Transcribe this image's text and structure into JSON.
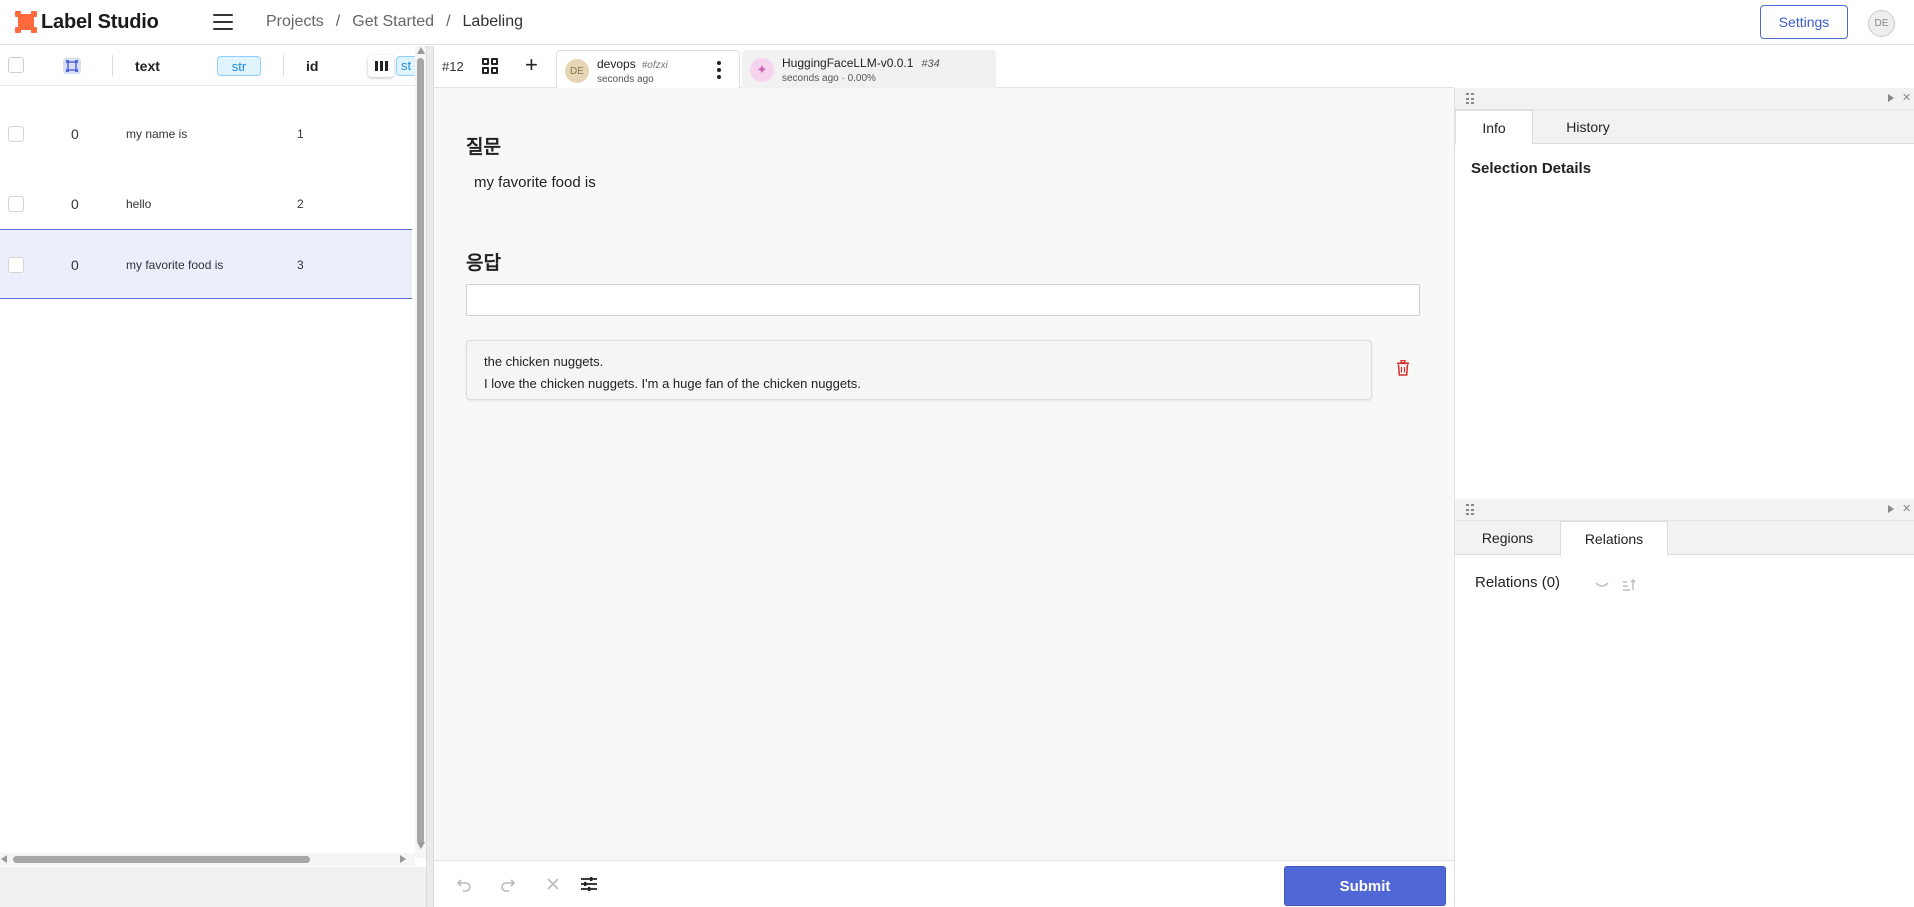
{
  "header": {
    "app_name": "Label Studio",
    "breadcrumb": [
      "Projects",
      "Get Started",
      "Labeling"
    ],
    "breadcrumb_sep": "/",
    "settings_label": "Settings",
    "user_initials": "DE"
  },
  "table": {
    "columns": {
      "text": "text",
      "text_type": "str",
      "id": "id",
      "extra_type": "st"
    },
    "rows": [
      {
        "count": "0",
        "text": "my name is",
        "id": "1"
      },
      {
        "count": "0",
        "text": "hello",
        "id": "2"
      },
      {
        "count": "0",
        "text": "my favorite food is",
        "id": "3"
      }
    ],
    "selected_row": 2
  },
  "annotation_bar": {
    "task_id": "#12",
    "annotation": {
      "initials": "DE",
      "name": "devops",
      "hash": "#ofzxi",
      "time": "seconds ago"
    },
    "prediction": {
      "icon": "✦",
      "name": "HuggingFaceLLM-v0.0.1",
      "hash": "#34",
      "meta": "seconds ago · 0.00%"
    }
  },
  "main": {
    "question_title": "질문",
    "question_text": "my favorite food is",
    "answer_title": "응답",
    "answer_input_value": "",
    "response_lines": [
      "the chicken nuggets.",
      "I love the chicken nuggets. I'm a huge fan of the chicken nuggets."
    ],
    "submit_label": "Submit"
  },
  "right_panel": {
    "top_tabs": [
      "Info",
      "History"
    ],
    "selection_details": "Selection Details",
    "bottom_tabs": [
      "Regions",
      "Relations"
    ],
    "relations_label": "Relations (0)"
  },
  "colors": {
    "accent": "#5067d6",
    "brand": "#ff6a3d",
    "danger": "#d32f2f",
    "badge": "#1b8be0"
  }
}
